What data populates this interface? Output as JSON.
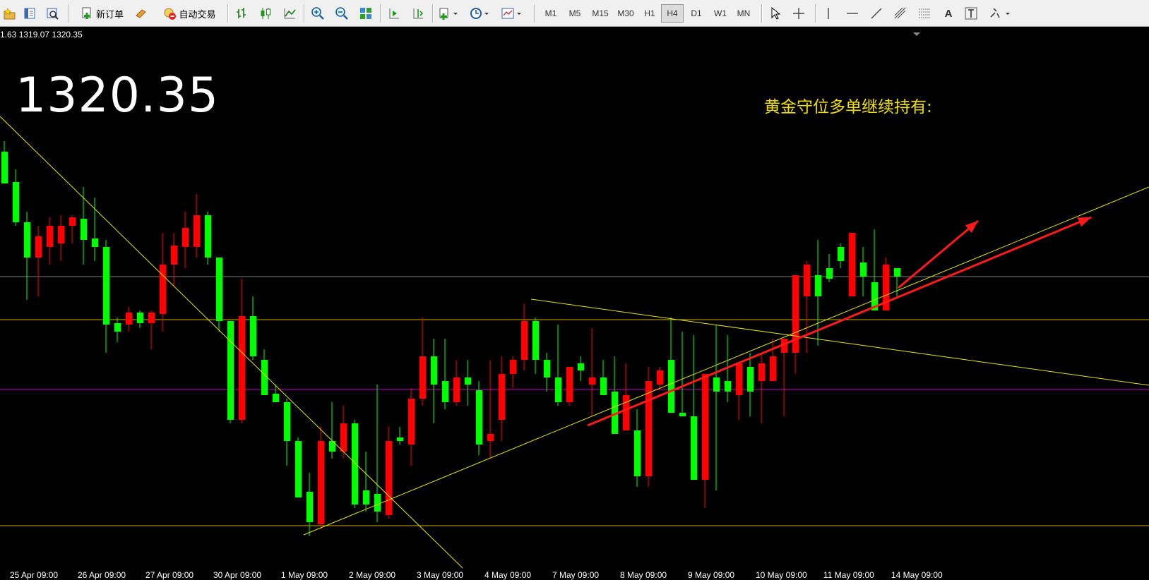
{
  "toolbar": {
    "new_order_label": "新订单",
    "auto_trading_label": "自动交易",
    "timeframes": [
      "M1",
      "M5",
      "M15",
      "M30",
      "H1",
      "H4",
      "D1",
      "W1",
      "MN"
    ],
    "active_timeframe": "H4"
  },
  "chart": {
    "ohlc_text": "1.63 1319.07 1320.35",
    "current_price": "1320.35",
    "annotation": "黄金守位多单继续持有:",
    "x_tick_labels": [
      "25 Apr 09:00",
      "26 Apr 09:00",
      "27 Apr 09:00",
      "30 Apr 09:00",
      "1 May 09:00",
      "2 May 09:00",
      "3 May 09:00",
      "4 May 09:00",
      "7 May 09:00",
      "8 May 09:00",
      "9 May 09:00",
      "10 May 09:00",
      "11 May 09:00",
      "14 May 09:00"
    ],
    "colors": {
      "background": "#000000",
      "bull_candle": "#00ff00",
      "bear_candle": "#ff0000",
      "trendline": "#e6e600",
      "horizontal_gray": "#808080",
      "horizontal_yellow": "#d4b000",
      "horizontal_magenta": "#c000c0",
      "arrow": "#ff1a1a",
      "annotation": "#f0e000"
    }
  }
}
